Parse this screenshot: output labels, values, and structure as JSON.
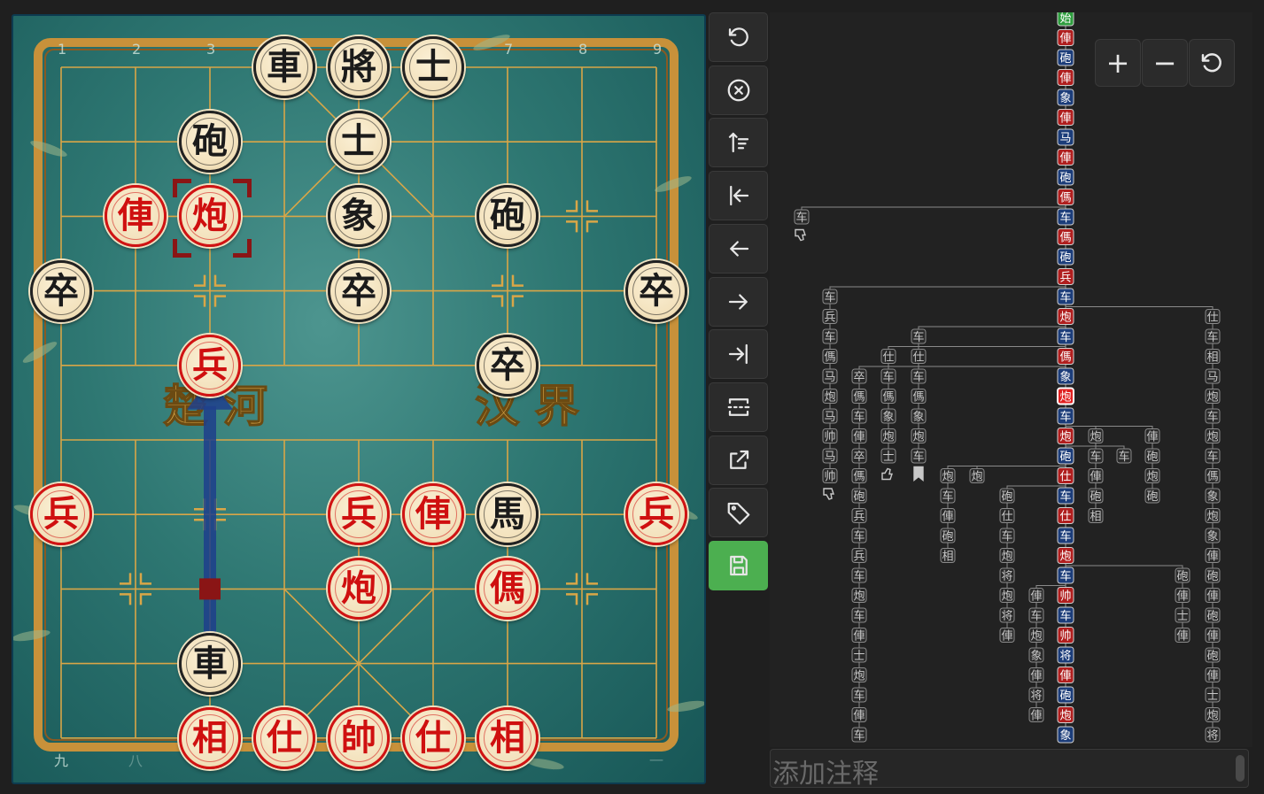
{
  "board": {
    "file_numbers_top": [
      "1",
      "2",
      "3",
      "",
      "",
      "",
      "7",
      "8",
      "9"
    ],
    "file_numbers_bottom": [
      "九",
      "八",
      "",
      "",
      "",
      "",
      "",
      "",
      "一"
    ],
    "river_left": "楚 河",
    "river_right": "汉 界",
    "pieces": [
      {
        "char": "車",
        "side": "black",
        "file": 3,
        "rank": 0
      },
      {
        "char": "將",
        "side": "black",
        "file": 4,
        "rank": 0
      },
      {
        "char": "士",
        "side": "black",
        "file": 5,
        "rank": 0
      },
      {
        "char": "砲",
        "side": "black",
        "file": 2,
        "rank": 1
      },
      {
        "char": "士",
        "side": "black",
        "file": 4,
        "rank": 1
      },
      {
        "char": "俥",
        "side": "red",
        "file": 1,
        "rank": 2
      },
      {
        "char": "炮",
        "side": "red",
        "file": 2,
        "rank": 2,
        "selected": true
      },
      {
        "char": "象",
        "side": "black",
        "file": 4,
        "rank": 2
      },
      {
        "char": "砲",
        "side": "black",
        "file": 6,
        "rank": 2
      },
      {
        "char": "卒",
        "side": "black",
        "file": 0,
        "rank": 3
      },
      {
        "char": "卒",
        "side": "black",
        "file": 4,
        "rank": 3
      },
      {
        "char": "卒",
        "side": "black",
        "file": 8,
        "rank": 3
      },
      {
        "char": "兵",
        "side": "red",
        "file": 2,
        "rank": 4
      },
      {
        "char": "卒",
        "side": "black",
        "file": 6,
        "rank": 4
      },
      {
        "char": "兵",
        "side": "red",
        "file": 0,
        "rank": 6
      },
      {
        "char": "兵",
        "side": "red",
        "file": 4,
        "rank": 6
      },
      {
        "char": "俥",
        "side": "red",
        "file": 5,
        "rank": 6
      },
      {
        "char": "馬",
        "side": "black",
        "file": 6,
        "rank": 6
      },
      {
        "char": "兵",
        "side": "red",
        "file": 8,
        "rank": 6
      },
      {
        "char": "炮",
        "side": "red",
        "file": 4,
        "rank": 7
      },
      {
        "char": "傌",
        "side": "red",
        "file": 6,
        "rank": 7
      },
      {
        "char": "車",
        "side": "black",
        "file": 2,
        "rank": 8
      },
      {
        "char": "相",
        "side": "red",
        "file": 2,
        "rank": 9
      },
      {
        "char": "仕",
        "side": "red",
        "file": 3,
        "rank": 9
      },
      {
        "char": "帥",
        "side": "red",
        "file": 4,
        "rank": 9
      },
      {
        "char": "仕",
        "side": "red",
        "file": 5,
        "rank": 9
      },
      {
        "char": "相",
        "side": "red",
        "file": 6,
        "rank": 9
      }
    ],
    "arrow": {
      "from_file": 2,
      "from_rank": 8,
      "to_file": 2,
      "to_rank": 4
    }
  },
  "toolbar": [
    {
      "name": "undo-button",
      "icon": "undo-icon"
    },
    {
      "name": "clear-button",
      "icon": "circle-x-icon"
    },
    {
      "name": "sort-button",
      "icon": "sort-icon"
    },
    {
      "name": "first-move-button",
      "icon": "to-start-icon"
    },
    {
      "name": "prev-move-button",
      "icon": "arrow-left-icon"
    },
    {
      "name": "next-move-button",
      "icon": "arrow-right-icon"
    },
    {
      "name": "last-move-button",
      "icon": "to-end-icon"
    },
    {
      "name": "fullscreen-button",
      "icon": "dashed-frame-icon"
    },
    {
      "name": "export-button",
      "icon": "external-link-icon"
    },
    {
      "name": "tag-button",
      "icon": "tag-icon"
    },
    {
      "name": "save-button",
      "icon": "save-icon"
    }
  ],
  "tree": {
    "main_line": [
      {
        "t": "始",
        "c": "green"
      },
      {
        "t": "俥",
        "c": "red"
      },
      {
        "t": "砲",
        "c": "blue"
      },
      {
        "t": "俥",
        "c": "red"
      },
      {
        "t": "象",
        "c": "blue"
      },
      {
        "t": "俥",
        "c": "red"
      },
      {
        "t": "马",
        "c": "blue"
      },
      {
        "t": "俥",
        "c": "red"
      },
      {
        "t": "砲",
        "c": "blue"
      },
      {
        "t": "傌",
        "c": "red"
      },
      {
        "t": "车",
        "c": "blue"
      },
      {
        "t": "傌",
        "c": "red"
      },
      {
        "t": "砲",
        "c": "blue"
      },
      {
        "t": "兵",
        "c": "red"
      },
      {
        "t": "车",
        "c": "blue"
      },
      {
        "t": "炮",
        "c": "red"
      },
      {
        "t": "车",
        "c": "blue"
      },
      {
        "t": "傌",
        "c": "red"
      },
      {
        "t": "象",
        "c": "blue"
      },
      {
        "t": "炮",
        "c": "redsel"
      },
      {
        "t": "车",
        "c": "blue"
      },
      {
        "t": "炮",
        "c": "red"
      },
      {
        "t": "砲",
        "c": "blue"
      },
      {
        "t": "仕",
        "c": "red"
      },
      {
        "t": "车",
        "c": "blue"
      },
      {
        "t": "仕",
        "c": "red"
      },
      {
        "t": "车",
        "c": "blue"
      },
      {
        "t": "炮",
        "c": "red"
      },
      {
        "t": "车",
        "c": "blue"
      },
      {
        "t": "帅",
        "c": "red"
      },
      {
        "t": "车",
        "c": "blue"
      },
      {
        "t": "帅",
        "c": "red"
      },
      {
        "t": "将",
        "c": "blue"
      },
      {
        "t": "俥",
        "c": "red"
      },
      {
        "t": "砲",
        "c": "blue"
      },
      {
        "t": "炮",
        "c": "red"
      },
      {
        "t": "象",
        "c": "blue"
      }
    ],
    "variations": [
      {
        "col": 36,
        "start": 10,
        "chars": [
          "车"
        ],
        "end": "thumb-down-icon"
      },
      {
        "col": 68,
        "start": 14,
        "chars": [
          "车",
          "兵",
          "车",
          "傌",
          "马",
          "炮",
          "马",
          "帅",
          "马",
          "帅"
        ],
        "end": "thumb-down-icon"
      },
      {
        "col": 101,
        "start": 18,
        "chars": [
          "卒",
          "傌",
          "车",
          "俥",
          "卒",
          "傌",
          "砲",
          "兵",
          "车",
          "兵",
          "车",
          "炮",
          "车",
          "俥",
          "士",
          "炮",
          "车",
          "俥",
          "车"
        ]
      },
      {
        "col": 134,
        "start": 17,
        "chars": [
          "仕",
          "车",
          "傌",
          "象",
          "炮",
          "士"
        ],
        "end": "thumb-up-icon"
      },
      {
        "col": 168,
        "start": 16,
        "chars": [
          "车",
          "仕",
          "车",
          "傌",
          "象",
          "炮",
          "车"
        ],
        "end": "bookmark-icon"
      },
      {
        "col": 201,
        "start": 23,
        "chars": [
          "炮",
          "车",
          "俥",
          "砲",
          "相"
        ]
      },
      {
        "col": 234,
        "start": 23,
        "chars": [
          "炮"
        ]
      },
      {
        "col": 268,
        "start": 24,
        "chars": [
          "砲",
          "仕",
          "车",
          "炮",
          "将",
          "炮",
          "将",
          "俥"
        ]
      },
      {
        "col": 301,
        "start": 29,
        "chars": [
          "俥",
          "车",
          "炮",
          "象",
          "俥",
          "将",
          "俥"
        ]
      },
      {
        "col": 368,
        "start": 21,
        "chars": [
          "炮",
          "车",
          "俥",
          "砲",
          "相"
        ]
      },
      {
        "col": 400,
        "start": 22,
        "chars": [
          "车"
        ]
      },
      {
        "col": 432,
        "start": 21,
        "chars": [
          "俥",
          "砲",
          "炮",
          "砲"
        ]
      },
      {
        "col": 466,
        "start": 28,
        "chars": [
          "砲",
          "俥",
          "士",
          "俥"
        ]
      },
      {
        "col": 500,
        "start": 15,
        "chars": [
          "仕",
          "车",
          "相",
          "马",
          "炮",
          "车",
          "炮",
          "车",
          "傌",
          "象",
          "炮",
          "象",
          "俥",
          "砲",
          "俥",
          "砲",
          "俥",
          "砲",
          "俥",
          "士",
          "炮",
          "将"
        ]
      }
    ]
  },
  "zoom": {
    "in_label": "+",
    "out_label": "−",
    "reset_icon": "reset-icon"
  },
  "comment": {
    "placeholder": "添加注释"
  }
}
